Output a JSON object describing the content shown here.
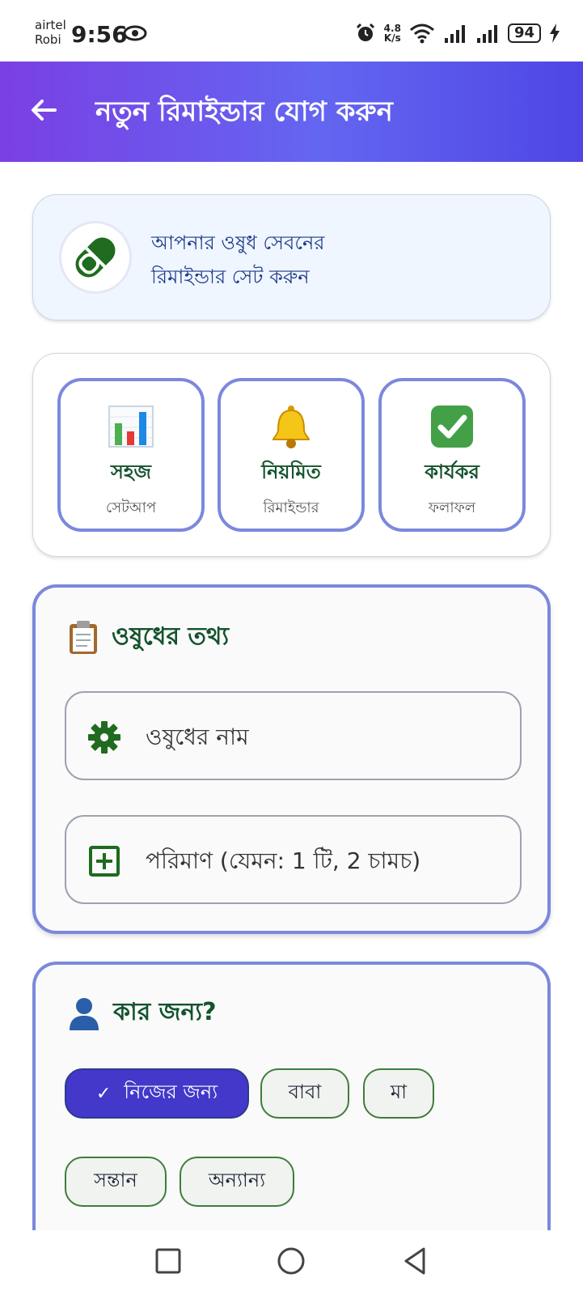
{
  "status_bar": {
    "carrier_1": "airtel",
    "carrier_2": "Robi",
    "time": "9:56",
    "net_speed_value": "4.8",
    "net_speed_unit": "K/s",
    "battery": "94"
  },
  "app_bar": {
    "title": "নতুন রিমাইন্ডার যোগ করুন",
    "background_start": "#7b3fe4",
    "background_end": "#4f46e5"
  },
  "intro": {
    "text_line_1": "আপনার ওষুধ সেবনের",
    "text_line_2": "রিমাইন্ডার সেট করুন",
    "icon": "pill-icon"
  },
  "features": [
    {
      "icon": "bar-chart-icon",
      "title": "সহজ",
      "subtitle": "সেটআপ"
    },
    {
      "icon": "bell-icon",
      "title": "নিয়মিত",
      "subtitle": "রিমাইন্ডার"
    },
    {
      "icon": "check-mark-icon",
      "title": "কার্যকর",
      "subtitle": "ফলাফল"
    }
  ],
  "medicine_info": {
    "title": "ওষুধের তথ্য",
    "title_icon": "clipboard-icon",
    "name_placeholder": "ওষুধের নাম",
    "name_icon": "gear-icon",
    "dosage_placeholder": "পরিমাণ (যেমন: 1 টি, 2 চামচ)",
    "dosage_icon": "plus-box-icon"
  },
  "for_whom": {
    "title": "কার জন্য?",
    "title_icon": "person-icon",
    "options": [
      "নিজের জন্য",
      "বাবা",
      "মা",
      "সন্তান",
      "অন্যান্য"
    ],
    "selected": "নিজের জন্য",
    "check_mark": "✓"
  },
  "nav_bar": {
    "buttons": [
      "recent-apps-icon",
      "home-icon",
      "back-icon"
    ]
  },
  "colors": {
    "accent": "#4338ca",
    "card_border": "#7b88dd",
    "heading_green": "#14532d",
    "chip_border": "#3f7d3a"
  }
}
